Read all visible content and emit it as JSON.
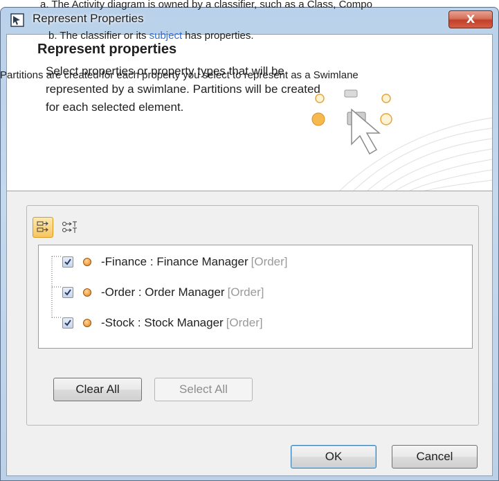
{
  "annotations": {
    "line_a": "a. The Activity diagram is owned by a classifier, such as a Class, Compo",
    "line_b_prefix": "b. The classifier or its ",
    "line_b_link": "subject",
    "line_b_suffix": " has properties.",
    "line_c": "Partitions are created for each property you select to represent as a Swimlane"
  },
  "window": {
    "title": "Represent Properties",
    "close_glyph": "X"
  },
  "header": {
    "title": "Represent properties",
    "description": "Select properties or property types that will be represented by a swimlane. Partitions will be created for each selected element."
  },
  "tree": {
    "items": [
      {
        "name": "-Finance",
        "type": "Finance Manager",
        "owner": "[Order]",
        "checked": true
      },
      {
        "name": "-Order",
        "type": "Order Manager",
        "owner": "[Order]",
        "checked": true
      },
      {
        "name": "-Stock",
        "type": "Stock Manager",
        "owner": "[Order]",
        "checked": true
      }
    ]
  },
  "buttons": {
    "clear_all": "Clear All",
    "select_all": "Select All",
    "ok": "OK",
    "cancel": "Cancel"
  },
  "colors": {
    "accent": "#f8c560",
    "link": "#2f6fd6",
    "close": "#c2402a"
  }
}
